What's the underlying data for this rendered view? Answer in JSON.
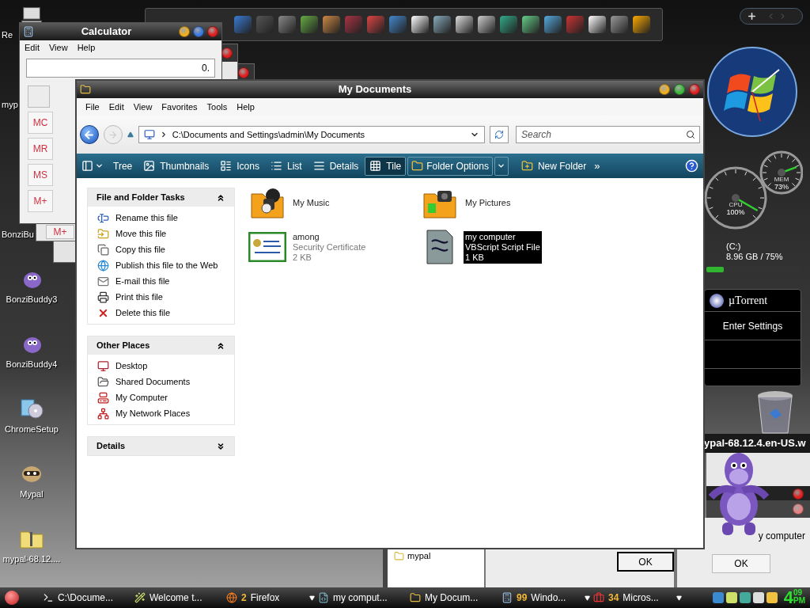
{
  "desktop_icons": [
    {
      "label": "Re",
      "kind": "computer"
    },
    {
      "label": "myp",
      "kind": "zip"
    },
    {
      "label": "BonziBu",
      "kind": "bonzi"
    },
    {
      "label": "BonziBuddy3",
      "kind": "bonzi"
    },
    {
      "label": "BonziBuddy4",
      "kind": "bonzi"
    },
    {
      "label": "ChromeSetup",
      "kind": "setup"
    },
    {
      "label": "Mypal",
      "kind": "raccoon"
    },
    {
      "label": "mypal-68.12....",
      "kind": "zip"
    }
  ],
  "behind_calculator": {
    "memory_button": "M+"
  },
  "calculator": {
    "title": "Calculator",
    "menu": [
      "Edit",
      "View",
      "Help"
    ],
    "display": "0.",
    "memory_buttons": [
      "MC",
      "MR",
      "MS",
      "M+"
    ]
  },
  "explorer": {
    "title": "My Documents",
    "menu": [
      "File",
      "Edit",
      "View",
      "Favorites",
      "Tools",
      "Help"
    ],
    "address": "C:\\Documents and Settings\\admin\\My Documents",
    "search": {
      "placeholder": "Search"
    },
    "views": [
      {
        "label": "Tree",
        "kind": "tree",
        "selected": false
      },
      {
        "label": "Thumbnails",
        "kind": "thumbnails",
        "selected": false
      },
      {
        "label": "Icons",
        "kind": "icons",
        "selected": false
      },
      {
        "label": "List",
        "kind": "list",
        "selected": false
      },
      {
        "label": "Details",
        "kind": "details",
        "selected": false
      },
      {
        "label": "Tile",
        "kind": "tile",
        "selected": true
      }
    ],
    "folder_options": "Folder Options",
    "new_folder": "New Folder",
    "more": "»",
    "task_panes": [
      {
        "title": "File and Folder Tasks",
        "expanded": true,
        "items": [
          {
            "label": "Rename this file",
            "kind": "rename"
          },
          {
            "label": "Move this file",
            "kind": "move"
          },
          {
            "label": "Copy this file",
            "kind": "copy"
          },
          {
            "label": "Publish this file to the Web",
            "kind": "publish"
          },
          {
            "label": "E-mail this file",
            "kind": "email"
          },
          {
            "label": "Print this file",
            "kind": "print"
          },
          {
            "label": "Delete this file",
            "kind": "delete"
          }
        ]
      },
      {
        "title": "Other Places",
        "expanded": true,
        "items": [
          {
            "label": "Desktop",
            "kind": "desktop"
          },
          {
            "label": "Shared Documents",
            "kind": "shared"
          },
          {
            "label": "My Computer",
            "kind": "computer"
          },
          {
            "label": "My Network Places",
            "kind": "network"
          }
        ]
      },
      {
        "title": "Details",
        "expanded": false
      }
    ],
    "files": [
      {
        "name": "My Music",
        "kind": "music",
        "selected": false
      },
      {
        "name": "My Pictures",
        "kind": "pictures",
        "selected": false
      },
      {
        "name": "among",
        "type": "Security Certificate",
        "size": "2 KB",
        "kind": "certificate",
        "selected": false
      },
      {
        "name": "my computer",
        "type": "VBScript Script File",
        "size": "1 KB",
        "kind": "script",
        "selected": true
      }
    ]
  },
  "gadgets": {
    "cpu": {
      "label": "CPU",
      "reading": "100%"
    },
    "memory": {
      "label": "MEM",
      "reading": "73%"
    },
    "drive": {
      "name": "(C:)",
      "usage": "8.96 GB / 75%",
      "level": 0.18
    },
    "utorrent": {
      "title": "µTorrent",
      "action": "Enter Settings"
    }
  },
  "folder_window": {
    "items": [
      "mypal"
    ]
  },
  "download_dialog": {
    "title": "ypal-68.12.4.en-US.w",
    "button": "OK"
  },
  "message_dialog": {
    "message": "y computer",
    "button": "OK"
  },
  "taskbar": {
    "items": [
      {
        "label": "C:\\Docume...",
        "kind": "console",
        "grouped": false
      },
      {
        "label": "Welcome t...",
        "kind": "wizard",
        "grouped": false
      },
      {
        "count": "2",
        "label": "Firefox",
        "kind": "browser",
        "grouped": true
      },
      {
        "label": "my comput...",
        "kind": "script",
        "grouped": false
      },
      {
        "label": "My Docum...",
        "kind": "folder",
        "grouped": false
      },
      {
        "count": "99",
        "label": "Windo...",
        "kind": "calculator",
        "grouped": true
      },
      {
        "count": "34",
        "label": "Micros...",
        "kind": "office",
        "grouped": true
      }
    ],
    "clock": {
      "hour": "4",
      "minute": "09",
      "period": "PM"
    }
  }
}
